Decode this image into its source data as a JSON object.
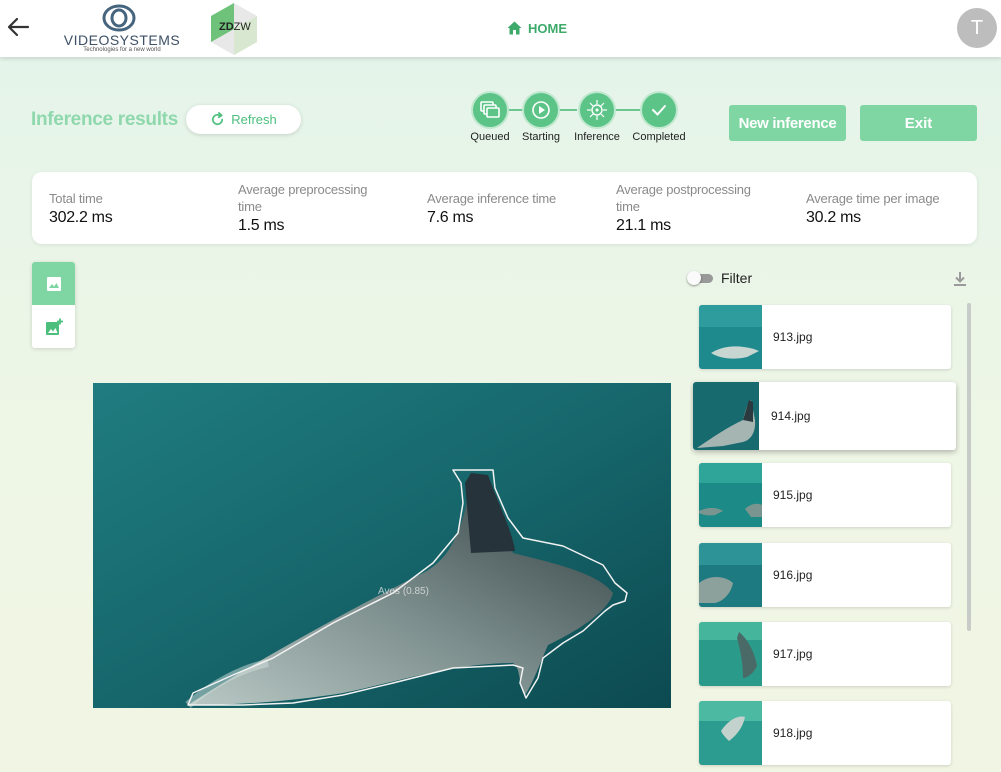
{
  "header": {
    "brand_name": "VIDEOSYSTEMS",
    "brand_tagline": "Technologies for a new world",
    "partner_logo_bold": "ZD",
    "partner_logo_light": "ZW",
    "home_label": "HOME",
    "avatar_initial": "T"
  },
  "toolbar": {
    "title": "Inference results",
    "refresh_label": "Refresh",
    "new_inference_label": "New inference",
    "exit_label": "Exit"
  },
  "stepper": {
    "steps": [
      {
        "label": "Queued",
        "icon": "queue-icon"
      },
      {
        "label": "Starting",
        "icon": "play-icon"
      },
      {
        "label": "Inference",
        "icon": "virus-icon"
      },
      {
        "label": "Completed",
        "icon": "check-icon"
      }
    ],
    "current": "Completed"
  },
  "stats": [
    {
      "label": "Total time",
      "value": "302.2 ms"
    },
    {
      "label": "Average preprocessing time",
      "value": "1.5 ms"
    },
    {
      "label": "Average inference time",
      "value": "7.6 ms"
    },
    {
      "label": "Average postprocessing time",
      "value": "21.1 ms"
    },
    {
      "label": "Average time per image",
      "value": "30.2 ms"
    }
  ],
  "viewer": {
    "annotation_label": "Aves (0.85)",
    "tools": [
      "image-icon",
      "add-image-icon"
    ]
  },
  "file_list": {
    "filter_label": "Filter",
    "filter_on": false,
    "items": [
      {
        "name": "913.jpg"
      },
      {
        "name": "914.jpg",
        "selected": true
      },
      {
        "name": "915.jpg"
      },
      {
        "name": "916.jpg"
      },
      {
        "name": "917.jpg"
      },
      {
        "name": "918.jpg"
      }
    ]
  },
  "colors": {
    "accent": "#5dc488",
    "button": "#7fd6a3",
    "title": "#8fd8ad",
    "water": "#1a6f73"
  }
}
